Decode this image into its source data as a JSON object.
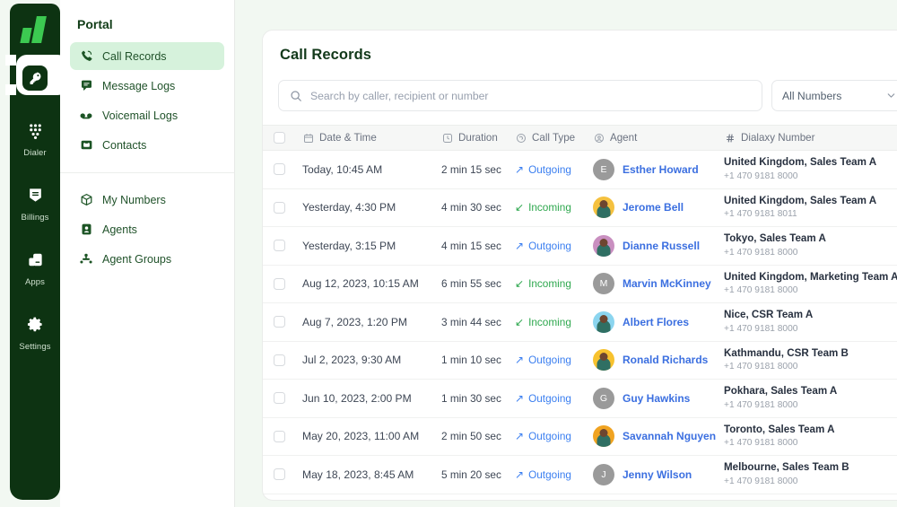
{
  "rail": {
    "logo": "dialaxy-logo",
    "items": [
      {
        "label": "",
        "icon": "key-portal-icon",
        "name": "portal",
        "active": true
      },
      {
        "label": "Dialer",
        "icon": "dialpad-icon",
        "name": "dialer",
        "active": false
      },
      {
        "label": "Billings",
        "icon": "billing-icon",
        "name": "billings",
        "active": false
      },
      {
        "label": "Apps",
        "icon": "apps-icon",
        "name": "apps",
        "active": false
      },
      {
        "label": "Settings",
        "icon": "gear-icon",
        "name": "settings",
        "active": false
      }
    ]
  },
  "sidebar": {
    "title": "Portal",
    "group1": [
      {
        "label": "Call Records",
        "icon": "phone-call-icon",
        "selected": true
      },
      {
        "label": "Message Logs",
        "icon": "message-icon",
        "selected": false
      },
      {
        "label": "Voicemail Logs",
        "icon": "voicemail-icon",
        "selected": false
      },
      {
        "label": "Contacts",
        "icon": "contacts-icon",
        "selected": false
      }
    ],
    "group2": [
      {
        "label": "My Numbers",
        "icon": "box-icon",
        "selected": false
      },
      {
        "label": "Agents",
        "icon": "agent-icon",
        "selected": false
      },
      {
        "label": "Agent Groups",
        "icon": "agent-groups-icon",
        "selected": false
      }
    ]
  },
  "main": {
    "title": "Call Records",
    "search": {
      "value": "",
      "placeholder": "Search by caller, recipient or number",
      "icon": "search-icon"
    },
    "numbers_filter": {
      "value": "All Numbers",
      "icon": "chevron-down-icon"
    },
    "columns": [
      {
        "label": "Date & Time",
        "icon": "calendar-icon"
      },
      {
        "label": "Duration",
        "icon": "clock-icon"
      },
      {
        "label": "Call Type",
        "icon": "call-type-icon"
      },
      {
        "label": "Agent",
        "icon": "user-circle-icon"
      },
      {
        "label": "Dialaxy Number",
        "icon": "hash-icon"
      }
    ],
    "rows": [
      {
        "date": "Today, 10:45 AM",
        "duration": "2 min 15 sec",
        "type": "Outgoing",
        "direction": "outgoing",
        "agent": "Esther Howard",
        "avatar_kind": "initial",
        "initial": "E",
        "avatar_color": "#9a9a9a",
        "location": "United Kingdom, Sales Team A",
        "number": "+1 470 9181 8000"
      },
      {
        "date": "Yesterday, 4:30 PM",
        "duration": "4 min 30 sec",
        "type": "Incoming",
        "direction": "incoming",
        "agent": "Jerome Bell",
        "avatar_kind": "photo",
        "initial": "J",
        "avatar_color": "#f5c13f",
        "location": "United Kingdom, Sales Team A",
        "number": "+1 470 9181 8011"
      },
      {
        "date": "Yesterday, 3:15 PM",
        "duration": "4 min 15 sec",
        "type": "Outgoing",
        "direction": "outgoing",
        "agent": "Dianne Russell",
        "avatar_kind": "photo",
        "initial": "D",
        "avatar_color": "#c98fc0",
        "location": "Tokyo, Sales Team A",
        "number": "+1 470 9181 8000"
      },
      {
        "date": "Aug 12, 2023, 10:15 AM",
        "duration": "6 min 55 sec",
        "type": "Incoming",
        "direction": "incoming",
        "agent": "Marvin McKinney",
        "avatar_kind": "initial",
        "initial": "M",
        "avatar_color": "#9a9a9a",
        "location": "United Kingdom, Marketing Team A",
        "number": "+1 470 9181 8000"
      },
      {
        "date": "Aug 7, 2023, 1:20 PM",
        "duration": "3 min 44 sec",
        "type": "Incoming",
        "direction": "incoming",
        "agent": "Albert Flores",
        "avatar_kind": "photo",
        "initial": "A",
        "avatar_color": "#8bd5ef",
        "location": "Nice, CSR Team A",
        "number": "+1 470 9181 8000"
      },
      {
        "date": "Jul 2, 2023, 9:30 AM",
        "duration": "1 min 10 sec",
        "type": "Outgoing",
        "direction": "outgoing",
        "agent": "Ronald Richards",
        "avatar_kind": "photo",
        "initial": "R",
        "avatar_color": "#f7c22e",
        "location": "Kathmandu, CSR Team B",
        "number": "+1 470 9181 8000"
      },
      {
        "date": "Jun 10, 2023, 2:00 PM",
        "duration": "1 min 30 sec",
        "type": "Outgoing",
        "direction": "outgoing",
        "agent": "Guy Hawkins",
        "avatar_kind": "initial",
        "initial": "G",
        "avatar_color": "#9a9a9a",
        "location": "Pokhara, Sales Team A",
        "number": "+1 470 9181 8000"
      },
      {
        "date": "May 20, 2023, 11:00 AM",
        "duration": "2 min 50 sec",
        "type": "Outgoing",
        "direction": "outgoing",
        "agent": "Savannah Nguyen",
        "avatar_kind": "photo",
        "initial": "S",
        "avatar_color": "#f0a321",
        "location": "Toronto, Sales Team A",
        "number": "+1 470 9181 8000"
      },
      {
        "date": "May 18, 2023, 8:45 AM",
        "duration": "5 min 20 sec",
        "type": "Outgoing",
        "direction": "outgoing",
        "agent": "Jenny Wilson",
        "avatar_kind": "initial",
        "initial": "J",
        "avatar_color": "#9a9a9a",
        "location": "Melbourne, Sales Team B",
        "number": "+1 470 9181 8000"
      }
    ]
  },
  "colors": {
    "rail_bg": "#0d3312",
    "brand_green": "#3cc951",
    "nav_selected_bg": "#d6f2dc",
    "outgoing": "#3b7ff0",
    "incoming": "#2fa84f",
    "agent_link": "#3b6fe0",
    "page_bg": "#f2f8f2"
  }
}
